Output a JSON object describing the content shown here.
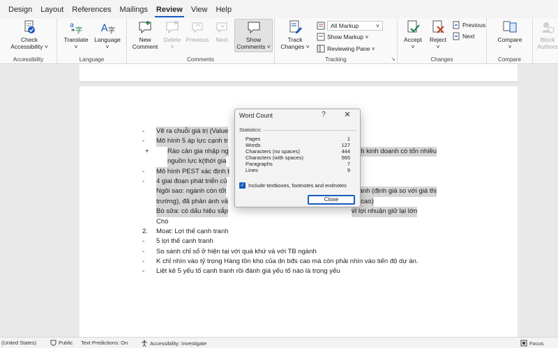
{
  "ribbon_tabs": [
    "Design",
    "Layout",
    "References",
    "Mailings",
    "Review",
    "View",
    "Help"
  ],
  "active_tab": "Review",
  "groups": {
    "accessibility": {
      "label": "Accessibility",
      "check_btn_line1": "Check",
      "check_btn_line2": "Accessibility ˅"
    },
    "language": {
      "label": "Language",
      "translate": "Translate",
      "translate_dd": "˅",
      "language": "Language",
      "language_dd": "˅"
    },
    "comments": {
      "label": "Comments",
      "new_line1": "New",
      "new_line2": "Comment",
      "delete": "Delete",
      "delete_dd": "˅",
      "previous": "Previous",
      "next": "Next",
      "show_line1": "Show",
      "show_line2": "Comments ˅"
    },
    "tracking": {
      "label": "Tracking",
      "track_line1": "Track",
      "track_line2": "Changes ˅",
      "all_markup": "All Markup",
      "show_markup": "Show Markup ˅",
      "reviewing_pane": "Reviewing Pane ˅",
      "launcher": "↘"
    },
    "changes": {
      "label": "Changes",
      "accept": "Accept",
      "accept_dd": "˅",
      "reject": "Reject",
      "reject_dd": "˅",
      "previous": "Previous",
      "next": "Next"
    },
    "compare": {
      "label": "Compare",
      "compare": "Compare",
      "compare_dd": "˅"
    },
    "protect": {
      "block_line1": "Block",
      "block_line2": "Authors"
    }
  },
  "colors": {
    "accent": "#185abd",
    "highlight": "#d6d6d6",
    "red": "#c43e1c",
    "green": "#107c41"
  },
  "document_lines": [
    {
      "bullet": "-",
      "text": "Vẽ ra chuỗi giá trị (Value",
      "hl": true
    },
    {
      "bullet": "-",
      "text": "Mô hình 5 áp lực cạnh tr",
      "hl": true
    },
    {
      "bullet": "+",
      "text": "Rào cản gia nhập ng",
      "tail": "hình kinh doanh có tốn nhiều",
      "hl": true
    },
    {
      "bullet": "",
      "text": "nguồn lực k(thời gia",
      "hl": true
    },
    {
      "bullet": "-",
      "text": "Mô hình PEST xác định t",
      "hl": true
    },
    {
      "bullet": "-",
      "text": "4 giai đoạn phát triển củ",
      "hl": true
    },
    {
      "bullet": "",
      "text": "Ngôi sao: ngành còn tốt",
      "tail": "ngành (định giá so với giá thị",
      "hl": true
    },
    {
      "bullet": "",
      "text": "trường), đã phản ánh và",
      "tail": "ng cao)",
      "hl": true
    },
    {
      "bullet": "",
      "text": "Bò sữa: có dấu hiệu sắp",
      "tail": "vì lợi nhuận giữ lại lớn",
      "hl": true
    },
    {
      "bullet": "",
      "text": "Chó",
      "hl": false
    },
    {
      "bullet": "2.",
      "text": "Moat: Lợi thế cạnh tranh",
      "hl": false
    },
    {
      "bullet": "-",
      "text": "5 lợi thế cạnh tranh",
      "hl": false
    },
    {
      "bullet": "-",
      "text": "So sánh chỉ số ở hiện tại với quá khứ và với TB ngành",
      "hl": false
    },
    {
      "bullet": "-",
      "text": "K chỉ nhìn vào tỷ trọng Hàng tồn kho của dn bđs cao mà còn phải nhìn vào tiến độ dự án.",
      "hl": false
    },
    {
      "bullet": "-",
      "text": "Liệt kê 5 yếu tố cạnh tranh rồi đánh giá yếu tố nào là trọng yếu",
      "hl": false
    }
  ],
  "dialog": {
    "title": "Word Count",
    "help": "?",
    "close_x": "✕",
    "statistics_label": "Statistics:",
    "stats": [
      {
        "label": "Pages",
        "value": "1"
      },
      {
        "label": "Words",
        "value": "127"
      },
      {
        "label": "Characters (no spaces)",
        "value": "444"
      },
      {
        "label": "Characters (with spaces)",
        "value": "565"
      },
      {
        "label": "Paragraphs",
        "value": "7"
      },
      {
        "label": "Lines",
        "value": "9"
      }
    ],
    "include_label": "Include textboxes, footnotes and endnotes",
    "include_checked": true,
    "close_button": "Close"
  },
  "statusbar": {
    "language": "(United States)",
    "public": "Public",
    "text_predictions": "Text Predictions: On",
    "accessibility": "Accessibility: Investigate",
    "focus": "Focus"
  }
}
